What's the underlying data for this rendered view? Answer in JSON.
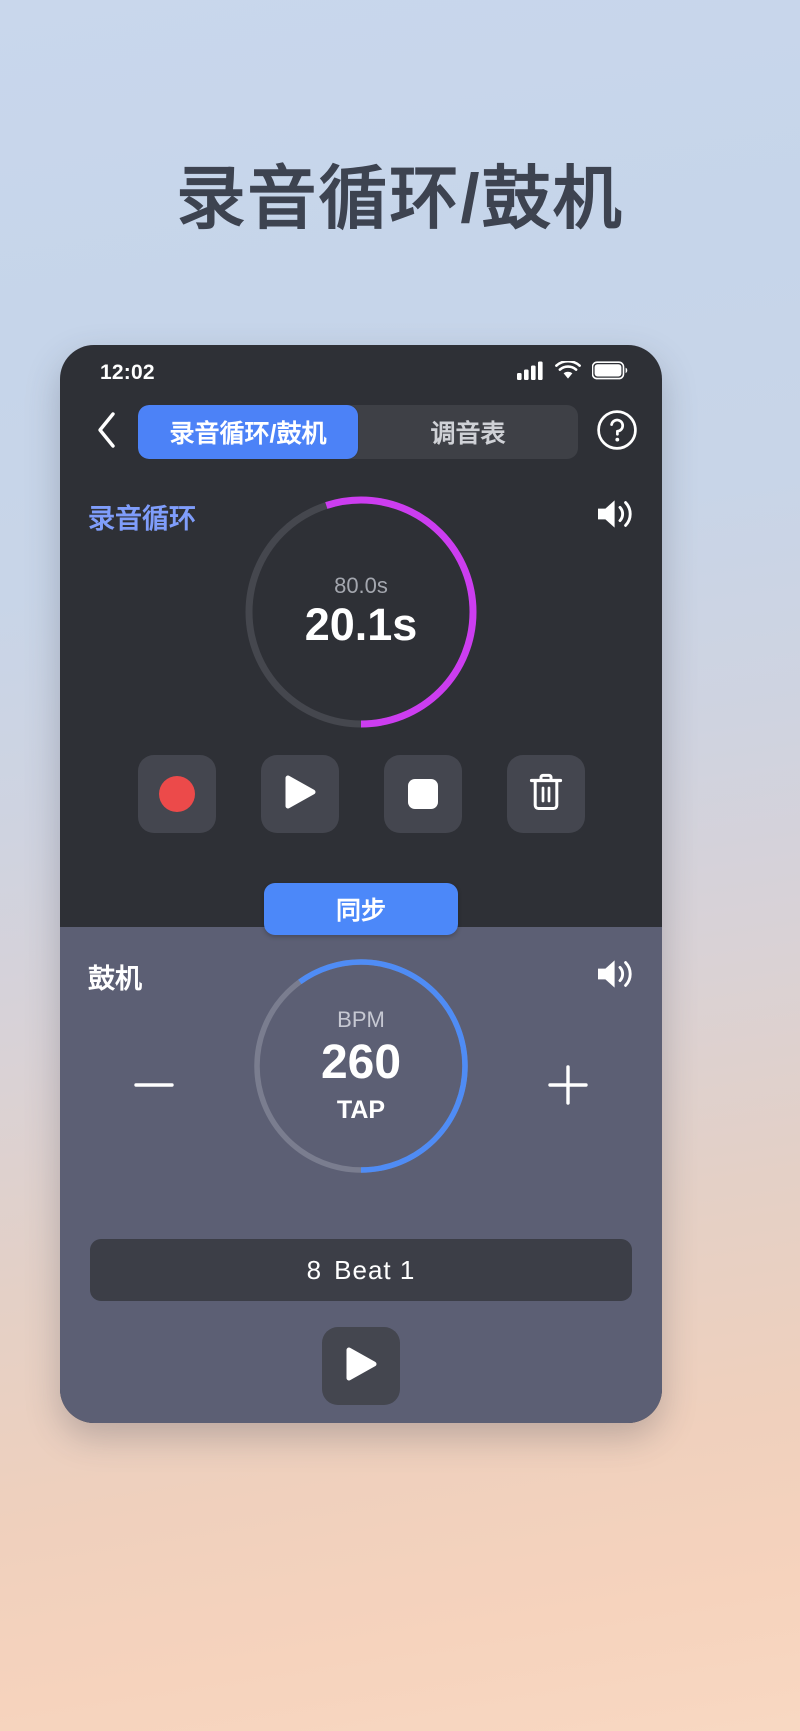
{
  "page": {
    "headline": "录音循环/鼓机"
  },
  "colors": {
    "accent_blue": "#4c82f7",
    "sync_blue": "#4c88f9",
    "looper_arc": "#cc3df0",
    "drum_arc": "#4f8cf5",
    "record_red": "#ec4a4a",
    "looper_bg": "#2e3036",
    "drum_bg": "#5c5f74",
    "section_title_blue": "#7f9dfb"
  },
  "statusbar": {
    "time": "12:02",
    "icons": [
      "cellular-signal-icon",
      "wifi-icon",
      "battery-icon"
    ]
  },
  "navbar": {
    "back_icon": "chevron-left-icon",
    "help_icon": "question-mark-circle-icon",
    "tabs": [
      {
        "label": "录音循环/鼓机",
        "active": true
      },
      {
        "label": "调音表",
        "active": false
      }
    ]
  },
  "looper": {
    "title": "录音循环",
    "volume_icon": "speaker-wave-icon",
    "dial": {
      "total_label": "80.0s",
      "current_label": "20.1s",
      "total_seconds": 80.0,
      "current_seconds": 20.1,
      "progress_percent": 55,
      "arc_color": "#cc3df0",
      "track_color": "#45474e"
    },
    "transport": [
      {
        "name": "record-button",
        "icon": "record-circle-icon"
      },
      {
        "name": "play-button",
        "icon": "play-triangle-icon"
      },
      {
        "name": "stop-button",
        "icon": "stop-square-icon"
      },
      {
        "name": "delete-button",
        "icon": "trash-icon"
      }
    ]
  },
  "sync": {
    "label": "同步"
  },
  "drum": {
    "title": "鼓机",
    "volume_icon": "speaker-wave-icon",
    "dial": {
      "unit_label": "BPM",
      "value": "260",
      "tap_label": "TAP",
      "progress_percent": 60,
      "arc_color": "#4f8cf5",
      "track_color": "#7a7d8f"
    },
    "decrement_icon": "minus-icon",
    "increment_icon": "plus-icon",
    "beat_selector": {
      "count": "8",
      "pattern": "Beat 1"
    },
    "play_icon": "play-triangle-icon"
  }
}
